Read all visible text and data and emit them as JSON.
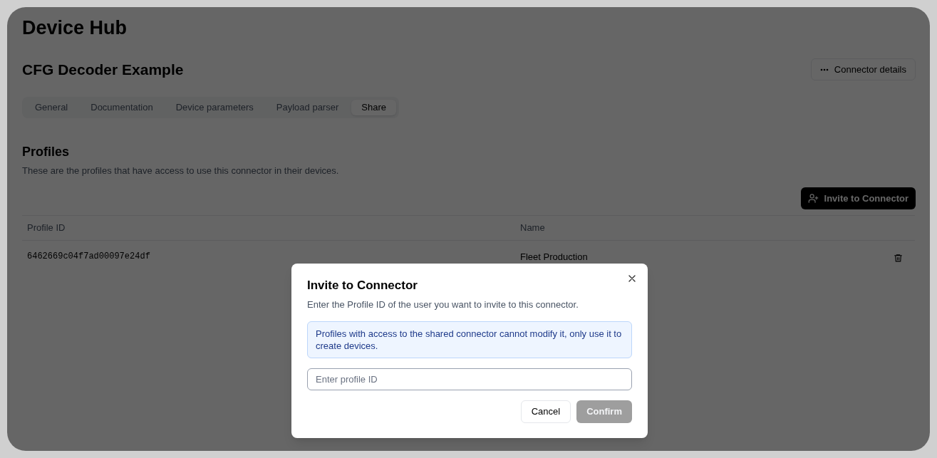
{
  "app_title": "Device Hub",
  "connector": {
    "title": "CFG Decoder Example",
    "details_button": "Connector details"
  },
  "tabs": [
    {
      "label": "General",
      "selected": false
    },
    {
      "label": "Documentation",
      "selected": false
    },
    {
      "label": "Device parameters",
      "selected": false
    },
    {
      "label": "Payload parser",
      "selected": false
    },
    {
      "label": "Share",
      "selected": true
    }
  ],
  "profiles": {
    "title": "Profiles",
    "description": "These are the profiles that have access to use this connector in their devices.",
    "invite_button": "Invite to Connector"
  },
  "table": {
    "columns": [
      "Profile ID",
      "Name"
    ],
    "rows": [
      {
        "profile_id": "6462669c04f7ad00097e24df",
        "name": "Fleet Production"
      }
    ]
  },
  "dialog": {
    "title": "Invite to Connector",
    "description": "Enter the Profile ID of the user you want to invite to this connector.",
    "notice": "Profiles with access to the shared connector cannot modify it, only use it to create devices.",
    "input": {
      "placeholder": "Enter profile ID"
    },
    "buttons": [
      {
        "label": "Cancel",
        "kind": "secondary",
        "disabled": false
      },
      {
        "label": "Confirm",
        "kind": "primary",
        "disabled": true
      }
    ]
  }
}
